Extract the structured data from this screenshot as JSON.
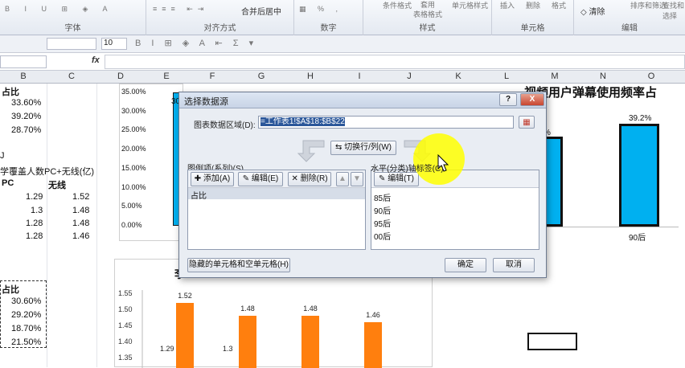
{
  "ribbon": {
    "font_group": "字体",
    "align_group": "对齐方式",
    "merge_label": "合并后居中",
    "number_group": "数字",
    "style_group": "样式",
    "cond_format": "条件格式",
    "table_format": "套用\n表格格式",
    "cell_style": "单元格样式",
    "cells_group": "单元格",
    "insert": "插入",
    "delete": "删除",
    "format": "格式",
    "clear": "清除",
    "sort": "排序和筛选",
    "find": "查找和选择",
    "edit_group": "编辑"
  },
  "quickbar": {
    "font_size": "10"
  },
  "formula_bar": {
    "fx": "fx",
    "value": ""
  },
  "columns": [
    "B",
    "C",
    "D",
    "E",
    "F",
    "G",
    "H",
    "I",
    "J",
    "K",
    "L",
    "M",
    "N",
    "O"
  ],
  "sheet": {
    "b_header": "占比",
    "b_values": [
      "33.60%",
      "39.20%",
      "28.70%"
    ],
    "j_label": "J",
    "coverage_text": "学覆盖人数PC+无线(亿)",
    "pc_header": "PC",
    "wireless_header": "无线",
    "rows": [
      {
        "pc": "1.29",
        "wl": "1.52"
      },
      {
        "pc": "1.3",
        "wl": "1.48"
      },
      {
        "pc": "1.28",
        "wl": "1.48"
      },
      {
        "pc": "1.28",
        "wl": "1.46"
      }
    ],
    "b2_header": "占比",
    "b2_values": [
      "30.60%",
      "29.20%",
      "18.70%",
      "21.50%"
    ]
  },
  "chart_top_right": {
    "title": "视频用户弹幕使用频率占",
    "bar_labels": [
      "%",
      "39.2%"
    ],
    "x_labels": [
      "90后"
    ]
  },
  "chart_data": [
    {
      "type": "bar",
      "title": "",
      "ylim": [
        0,
        0.35
      ],
      "yticks": [
        "35.00%",
        "30.00%",
        "25.00%",
        "20.00%",
        "15.00%",
        "10.00%",
        "5.00%",
        "0.00%"
      ],
      "visible_label": "30"
    },
    {
      "type": "bar",
      "title": "",
      "ylim": [
        1.35,
        1.55
      ],
      "yticks": [
        "1.55",
        "1.50",
        "1.45",
        "1.40",
        "1.35"
      ],
      "categories": [
        "85后",
        "90后",
        "95后",
        "00后"
      ],
      "series": [
        {
          "name": "PC",
          "values": [
            1.29,
            1.3,
            1.28,
            1.28
          ]
        },
        {
          "name": "无线",
          "values": [
            1.52,
            1.48,
            1.48,
            1.46
          ]
        }
      ],
      "data_labels": [
        "1.52",
        "1.48",
        "1.48",
        "1.46"
      ],
      "low_labels": [
        "1.29",
        "1.3"
      ]
    }
  ],
  "dialog": {
    "title": "选择数据源",
    "range_label": "图表数据区域(D):",
    "range_value": "=工作表1!$A$18:$B$22",
    "switch_button": "切换行/列(W)",
    "legend_label": "图例项(系列)(S)",
    "add_button": "添加(A)",
    "edit_button": "编辑(E)",
    "delete_button": "删除(R)",
    "series": [
      "占比"
    ],
    "axis_label": "水平(分类)轴标签(C)",
    "axis_edit_button": "编辑(T)",
    "categories": [
      "85后",
      "90后",
      "95后",
      "00后"
    ],
    "hidden_button": "隐藏的单元格和空单元格(H)",
    "ok_button": "确定",
    "cancel_button": "取消",
    "help_icon": "?",
    "close_icon": "X"
  },
  "colors": {
    "orange": "#ff7f0e",
    "blue": "#00b0f0"
  }
}
